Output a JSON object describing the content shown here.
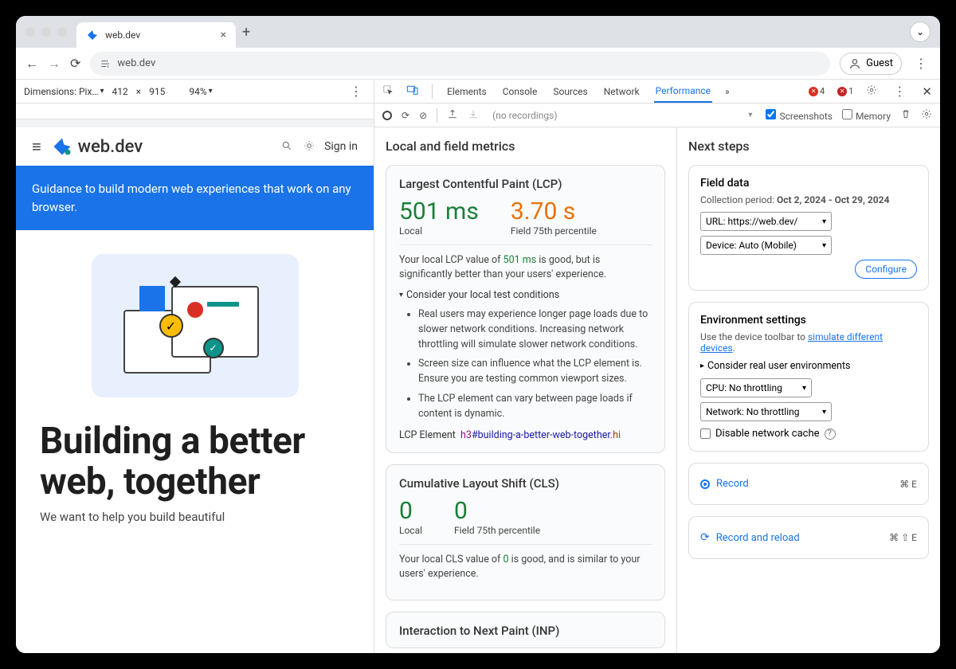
{
  "browser": {
    "tab_title": "web.dev",
    "url": "web.dev",
    "guest": "Guest"
  },
  "device_toolbar": {
    "dimensions_label": "Dimensions: Pix…",
    "width": "412",
    "height": "915",
    "zoom": "94%"
  },
  "devtools_tabs": {
    "elements": "Elements",
    "console": "Console",
    "sources": "Sources",
    "network": "Network",
    "performance": "Performance",
    "errors": "4",
    "warnings": "1"
  },
  "perf_toolbar": {
    "recording_placeholder": "(no recordings)",
    "screenshots": "Screenshots",
    "memory": "Memory"
  },
  "metrics": {
    "title": "Local and field metrics",
    "lcp": {
      "heading": "Largest Contentful Paint (LCP)",
      "local_val": "501 ms",
      "local_label": "Local",
      "field_val": "3.70 s",
      "field_label": "Field 75th percentile",
      "desc_pre": "Your local LCP value of ",
      "desc_hl": "501 ms",
      "desc_post": " is good, but is significantly better than your users' experience.",
      "summary": "Consider your local test conditions",
      "bullet1": "Real users may experience longer page loads due to slower network conditions. Increasing network throttling will simulate slower network conditions.",
      "bullet2": "Screen size can influence what the LCP element is. Ensure you are testing common viewport sizes.",
      "bullet3": "The LCP element can vary between page loads if content is dynamic.",
      "el_label": "LCP Element",
      "el_tag": "h3",
      "el_id": "#building-a-better-web-together",
      "el_cls": ".hi"
    },
    "cls": {
      "heading": "Cumulative Layout Shift (CLS)",
      "local_val": "0",
      "local_label": "Local",
      "field_val": "0",
      "field_label": "Field 75th percentile",
      "desc_pre": "Your local CLS value of ",
      "desc_hl": "0",
      "desc_post": " is good, and is similar to your users' experience."
    },
    "inp": {
      "heading": "Interaction to Next Paint (INP)"
    }
  },
  "next": {
    "title": "Next steps",
    "field": {
      "heading": "Field data",
      "period_label": "Collection period: ",
      "period_value": "Oct 2, 2024 - Oct 29, 2024",
      "url_sel": "URL: https://web.dev/",
      "device_sel": "Device: Auto (Mobile)",
      "configure": "Configure"
    },
    "env": {
      "heading": "Environment settings",
      "hint_pre": "Use the device toolbar to ",
      "hint_link": "simulate different devices",
      "details": "Consider real user environments",
      "cpu_sel": "CPU: No throttling",
      "net_sel": "Network: No throttling",
      "cache": "Disable network cache"
    },
    "record": {
      "record_label": "Record",
      "record_kbd": "⌘ E",
      "reload_label": "Record and reload",
      "reload_kbd": "⌘ ⇧ E"
    }
  },
  "site": {
    "title": "web.dev",
    "signin": "Sign in",
    "banner": "Guidance to build modern web experiences that work on any browser.",
    "hero_title": "Building a better web, together",
    "hero_sub": "We want to help you build beautiful"
  }
}
